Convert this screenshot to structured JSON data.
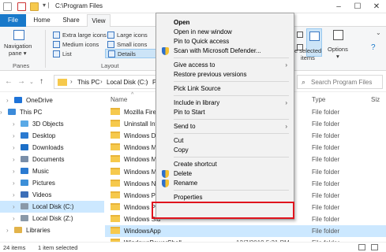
{
  "window": {
    "title": "C:\\Program Files"
  },
  "tabs": [
    "File",
    "Home",
    "Share",
    "View"
  ],
  "ribbon": {
    "navigation_pane": [
      "Navigation",
      "pane ▾"
    ],
    "panes_label": "Panes",
    "layout": [
      "Extra large icons",
      "Large icons",
      "Medium icons",
      "Small icons",
      "List",
      "Details"
    ],
    "layout_label": "Layout",
    "hide_selected": [
      "e selected",
      "items"
    ],
    "options": "Options"
  },
  "address": {
    "this_pc": "This PC",
    "disk": "Local Disk (C:)",
    "tail": "P",
    "search_placeholder": "Search Program Files"
  },
  "nav_items": [
    {
      "label": "OneDrive",
      "icon": "cloud-icon",
      "color": "#1e73d8"
    },
    {
      "label": "This PC",
      "icon": "pc-icon",
      "color": "#3b8ad9"
    },
    {
      "label": "3D Objects",
      "icon": "cube-icon",
      "color": "#5aa9e6"
    },
    {
      "label": "Desktop",
      "icon": "desktop-icon",
      "color": "#2a7ad1"
    },
    {
      "label": "Downloads",
      "icon": "download-icon",
      "color": "#1c6fc8"
    },
    {
      "label": "Documents",
      "icon": "document-icon",
      "color": "#7a8ea8"
    },
    {
      "label": "Music",
      "icon": "music-icon",
      "color": "#2a7ad1"
    },
    {
      "label": "Pictures",
      "icon": "picture-icon",
      "color": "#3c8fd8"
    },
    {
      "label": "Videos",
      "icon": "video-icon",
      "color": "#3c6fb8"
    },
    {
      "label": "Local Disk (C:)",
      "icon": "disk-icon",
      "color": "#8a99a8"
    },
    {
      "label": "Local Disk (Z:)",
      "icon": "disk-icon",
      "color": "#8a99a8"
    },
    {
      "label": "Libraries",
      "icon": "library-icon",
      "color": "#e2b34a"
    }
  ],
  "columns": {
    "name": "Name",
    "type": "Type",
    "size": "Siz"
  },
  "files": [
    {
      "name": "Mozilla Firefo",
      "type": "File folder"
    },
    {
      "name": "Uninstall Info",
      "type": "File folder"
    },
    {
      "name": "Windows Def",
      "type": "File folder"
    },
    {
      "name": "Windows Ma",
      "type": "File folder"
    },
    {
      "name": "Windows Me",
      "type": "File folder"
    },
    {
      "name": "Windows Mu",
      "type": "File folder"
    },
    {
      "name": "Windows NT",
      "type": "File folder"
    },
    {
      "name": "Windows Pho",
      "type": "File folder"
    },
    {
      "name": "Windows Por",
      "type": "File folder"
    },
    {
      "name": "Windows Sid",
      "type": "File folder"
    },
    {
      "name": "WindowsApp",
      "type": "File folder"
    },
    {
      "name": "WindowsPowerShell",
      "date": "12/7/2019 5:31 PM",
      "type": "File folder"
    }
  ],
  "status": {
    "items": "24 items",
    "selected": "1 item selected"
  },
  "context_menu": [
    {
      "label": "Open",
      "bold": true
    },
    {
      "label": "Open in new window"
    },
    {
      "label": "Pin to Quick access"
    },
    {
      "label": "Scan with Microsoft Defender...",
      "icon": "defender-icon"
    },
    {
      "sep": true
    },
    {
      "label": "Give access to",
      "submenu": true
    },
    {
      "label": "Restore previous versions"
    },
    {
      "sep": true
    },
    {
      "label": "Pick Link Source"
    },
    {
      "sep": true
    },
    {
      "label": "Include in library",
      "submenu": true
    },
    {
      "label": "Pin to Start"
    },
    {
      "sep": true
    },
    {
      "label": "Send to",
      "submenu": true
    },
    {
      "sep": true
    },
    {
      "label": "Cut"
    },
    {
      "label": "Copy"
    },
    {
      "sep": true
    },
    {
      "label": "Create shortcut"
    },
    {
      "label": "Delete",
      "icon": "shield-icon"
    },
    {
      "label": "Rename",
      "icon": "shield-icon"
    },
    {
      "sep": true
    },
    {
      "label": "Properties"
    }
  ]
}
